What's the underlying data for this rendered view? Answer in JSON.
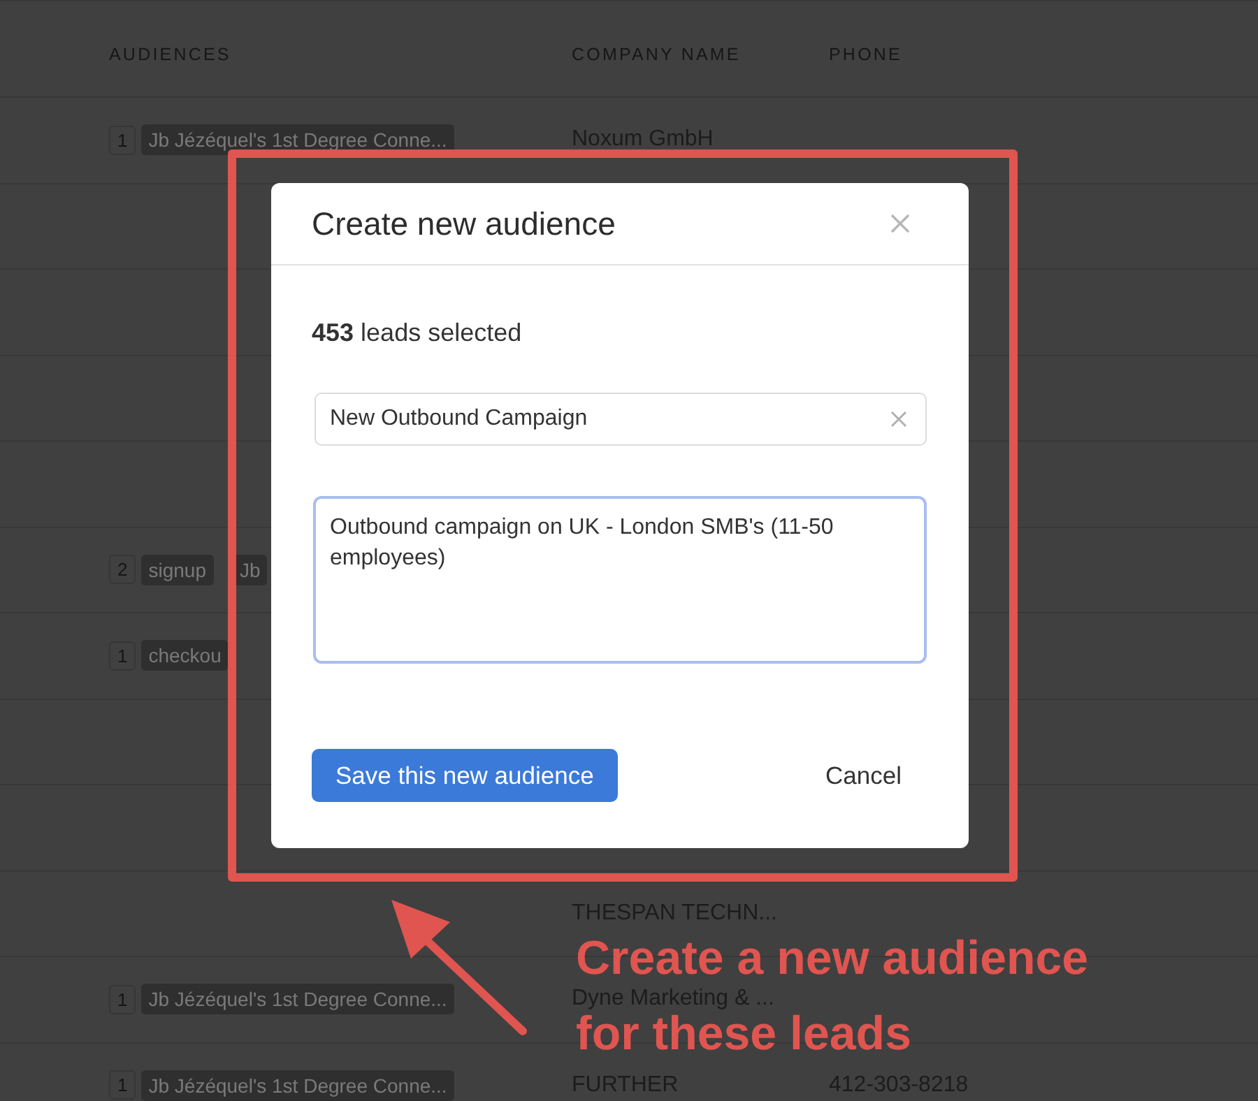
{
  "table": {
    "columns": [
      "AUDIENCES",
      "COMPANY NAME",
      "PHONE"
    ],
    "rows": [
      {
        "count": "1",
        "tags": [
          "Jb Jézéquel's 1st Degree Conne..."
        ],
        "company": "Noxum GmbH"
      },
      {},
      {},
      {},
      {},
      {
        "count": "2",
        "tags": [
          "signup",
          "Jb"
        ]
      },
      {
        "count": "1",
        "tags": [
          "checkou"
        ]
      },
      {},
      {},
      {
        "company": "THESPAN TECHN..."
      },
      {
        "count": "1",
        "tags": [
          "Jb Jézéquel's 1st Degree Conne..."
        ],
        "company": "Dyne Marketing & ..."
      },
      {
        "count": "1",
        "tags": [
          "Jb Jézéquel's 1st Degree Conne..."
        ],
        "company": "FURTHER",
        "phone": "412-303-8218"
      }
    ]
  },
  "modal": {
    "title": "Create new audience",
    "summary": "**453** leads selected",
    "name_value": "New Outbound Campaign",
    "description_value": "Outbound campaign on UK - London SMB's (11-50 employees)",
    "save_button": "Save this new audience",
    "cancel_button": "Cancel"
  },
  "annotation": {
    "lines": [
      "Create a new audience",
      "for these leads"
    ]
  }
}
